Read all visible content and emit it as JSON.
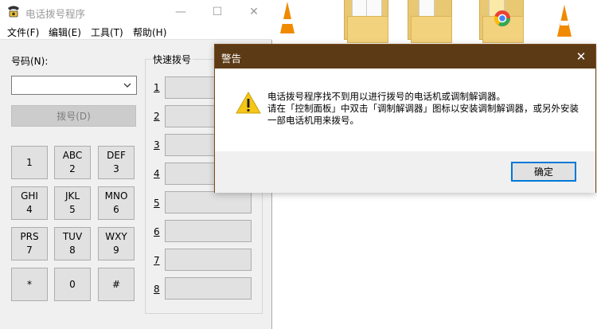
{
  "dialer": {
    "title": "电话拨号程序",
    "window_controls": {
      "minimize": "—",
      "maximize": "☐",
      "close": "✕"
    },
    "menu": [
      "文件(F)",
      "编辑(E)",
      "工具(T)",
      "帮助(H)"
    ],
    "number_label": "号码(N):",
    "number_value": "",
    "dial_button": "拨号(D)",
    "speed_dial_title": "快速拨号",
    "keys": [
      {
        "letters": "",
        "digit": "1"
      },
      {
        "letters": "ABC",
        "digit": "2"
      },
      {
        "letters": "DEF",
        "digit": "3"
      },
      {
        "letters": "GHI",
        "digit": "4"
      },
      {
        "letters": "JKL",
        "digit": "5"
      },
      {
        "letters": "MNO",
        "digit": "6"
      },
      {
        "letters": "PRS",
        "digit": "7"
      },
      {
        "letters": "TUV",
        "digit": "8"
      },
      {
        "letters": "WXY",
        "digit": "9"
      },
      {
        "letters": "",
        "digit": "*"
      },
      {
        "letters": "",
        "digit": "0"
      },
      {
        "letters": "",
        "digit": "#"
      }
    ],
    "speed_dial_numbers": [
      "1",
      "2",
      "3",
      "4",
      "5",
      "6",
      "7",
      "8"
    ]
  },
  "alert": {
    "title": "警告",
    "close": "✕",
    "message_lines": [
      "电话拨号程序找不到用以进行拨号的电话机或调制解调器。",
      "请在「控制面板」中双击「调制解调器」图标以安装调制解调器，或另外安装",
      "一部电话机用来拨号。"
    ],
    "ok_button": "确定",
    "icon": "warning-icon"
  },
  "colors": {
    "alert_titlebar": "#5c3a15",
    "ok_focus": "#0078d7",
    "warning": "#f5c518"
  }
}
